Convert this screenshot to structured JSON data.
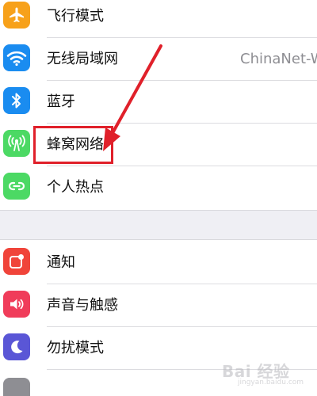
{
  "settings_group_1": {
    "items": [
      {
        "label": "飞行模式",
        "icon": "airplane-icon",
        "icon_color": "#f7a11a"
      },
      {
        "label": "无线局域网",
        "value": "ChinaNet-W",
        "icon": "wifi-icon",
        "icon_color": "#1a8cf0"
      },
      {
        "label": "蓝牙",
        "icon": "bluetooth-icon",
        "icon_color": "#1a8cf0"
      },
      {
        "label": "蜂窝网络",
        "icon": "cellular-antenna-icon",
        "icon_color": "#4cd964"
      },
      {
        "label": "个人热点",
        "icon": "personal-hotspot-icon",
        "icon_color": "#4cd964"
      }
    ]
  },
  "settings_group_2": {
    "items": [
      {
        "label": "通知",
        "icon": "notifications-icon",
        "icon_color": "#f0443a"
      },
      {
        "label": "声音与触感",
        "icon": "sound-icon",
        "icon_color": "#f03c5a"
      },
      {
        "label": "勿扰模式",
        "icon": "do-not-disturb-moon-icon",
        "icon_color": "#5a56d6"
      }
    ]
  },
  "annotation": {
    "highlight_color": "#e0202a",
    "highlighted_item": "蜂窝网络"
  },
  "watermark": {
    "text": "Bai 经验",
    "subtext": "jingyan.baidu.com"
  }
}
